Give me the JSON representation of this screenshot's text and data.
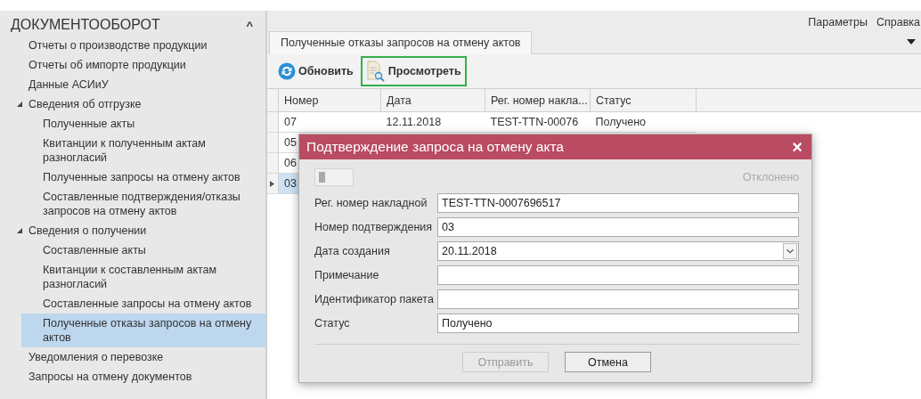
{
  "sidebar": {
    "title": "ДОКУМЕНТООБОРОТ",
    "collapse_icon": "^",
    "items": [
      {
        "label": "Отчеты о производстве продукции",
        "selected": false
      },
      {
        "label": "Отчеты об импорте продукции",
        "selected": false
      },
      {
        "label": "Данные АСИиУ",
        "selected": false
      },
      {
        "label": "Сведения об отгрузке",
        "selected": false,
        "expanded": true,
        "children": [
          {
            "label": "Полученные акты",
            "selected": false
          },
          {
            "label": "Квитанции к полученным актам разногласий",
            "selected": false
          },
          {
            "label": "Полученные запросы на отмену актов",
            "selected": false
          },
          {
            "label": "Составленные подтверждения/отказы запросов на отмену актов",
            "selected": false
          }
        ]
      },
      {
        "label": "Сведения о получении",
        "selected": false,
        "expanded": true,
        "children": [
          {
            "label": "Составленные акты",
            "selected": false
          },
          {
            "label": "Квитанции к составленным актам разногласий",
            "selected": false
          },
          {
            "label": "Составленные запросы на отмену актов",
            "selected": false
          },
          {
            "label": "Полученные отказы запросов на отмену актов",
            "selected": true
          }
        ]
      },
      {
        "label": "Уведомления о перевозке",
        "selected": false
      },
      {
        "label": "Запросы на отмену документов",
        "selected": false
      }
    ]
  },
  "menu": [
    "Параметры",
    "Справка"
  ],
  "tabs": [
    {
      "label": "Полученные отказы запросов на отмену актов"
    }
  ],
  "toolbar": [
    {
      "label": "Обновить",
      "kind": "refresh",
      "highlighted": false
    },
    {
      "label": "Просмотреть",
      "kind": "view",
      "highlighted": true
    }
  ],
  "table": {
    "columns": [
      "Номер",
      "Дата",
      "Рег. номер накла...",
      "Статус"
    ],
    "rows": [
      {
        "cells": [
          "07",
          "12.11.2018",
          "TEST-TTN-00076",
          "Получено"
        ],
        "selected": false
      },
      {
        "cells": [
          "05"
        ],
        "selected": false
      },
      {
        "cells": [
          "06"
        ],
        "selected": false
      },
      {
        "cells": [
          "03"
        ],
        "selected": true
      }
    ]
  },
  "dialog": {
    "title": "Подтверждение запроса на отмену акта",
    "close": "×",
    "toggle": {
      "on": false,
      "label": "Отклонено"
    },
    "fields": [
      {
        "label": "Рег. номер накладной",
        "value": "TEST-TTN-0007696517",
        "kind": "text"
      },
      {
        "label": "Номер подтверждения",
        "value": "03",
        "kind": "text"
      },
      {
        "label": "Дата создания",
        "value": "20.11.2018",
        "kind": "date"
      },
      {
        "label": "Примечание",
        "kind": "text"
      },
      {
        "label": "Идентификатор пакета",
        "kind": "text"
      },
      {
        "label": "Статус",
        "value": "Получено",
        "kind": "text"
      }
    ],
    "buttons": [
      {
        "label": "Отправить",
        "disabled": true
      },
      {
        "label": "Отмена",
        "disabled": false
      }
    ]
  }
}
